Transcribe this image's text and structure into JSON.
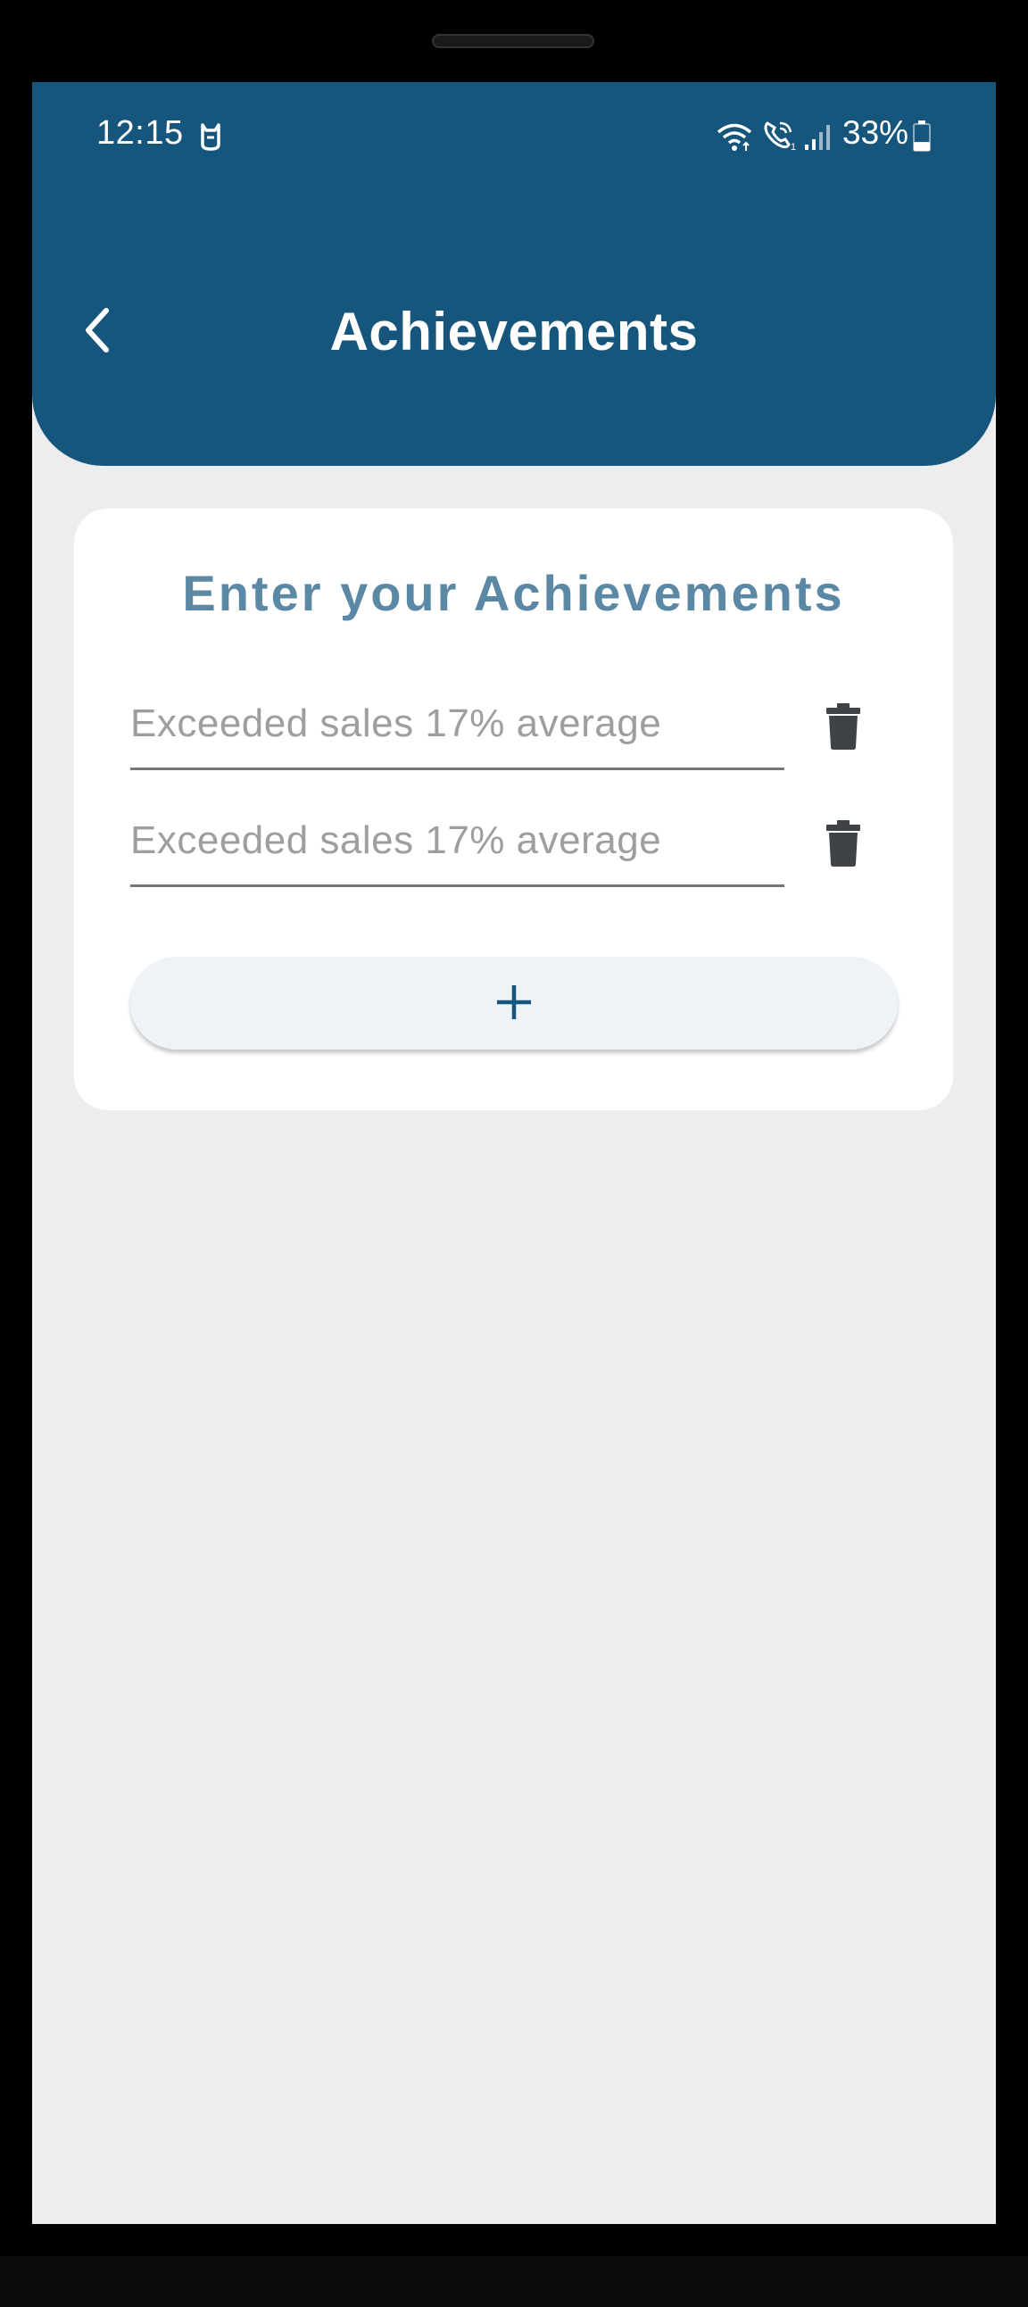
{
  "status_bar": {
    "time": "12:15",
    "battery_percent": "33%",
    "battery_level": 0.33,
    "icons": [
      "cat-notification-icon",
      "wifi-icon",
      "wifi-call-icon",
      "signal-icon",
      "battery-icon"
    ]
  },
  "header": {
    "title": "Achievements",
    "back_icon": "chevron-left-icon",
    "color": "#16567c"
  },
  "card": {
    "title": "Enter your Achievements",
    "fields": [
      {
        "placeholder": "Exceeded sales 17% average",
        "value": ""
      },
      {
        "placeholder": "Exceeded sales 17% average",
        "value": ""
      }
    ],
    "delete_icon": "trash-icon",
    "add_button_label": "+"
  },
  "colors": {
    "accent": "#16567c",
    "card_title": "#5b88a4",
    "background": "#ededed",
    "add_button_bg": "#eef3f7"
  }
}
